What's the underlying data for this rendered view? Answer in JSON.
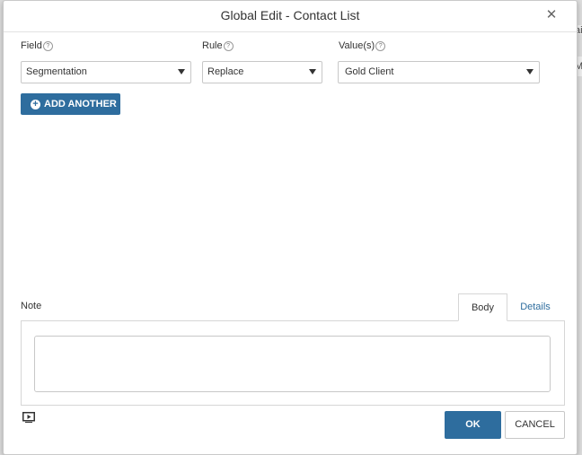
{
  "dialog": {
    "title": "Global Edit - Contact List",
    "close_glyph": "✕"
  },
  "background": {
    "fragments": [
      "ai",
      "M",
      ":"
    ]
  },
  "form": {
    "field": {
      "label": "Field",
      "value": "Segmentation"
    },
    "rule": {
      "label": "Rule",
      "value": "Replace"
    },
    "values": {
      "label": "Value(s)",
      "value": "Gold Client"
    },
    "help_glyph": "?",
    "add_another_label": "ADD ANOTHER"
  },
  "note": {
    "label": "Note",
    "tabs": [
      {
        "label": "Body",
        "active": true
      },
      {
        "label": "Details",
        "active": false
      }
    ],
    "body_text": ""
  },
  "footer": {
    "ok_label": "OK",
    "cancel_label": "CANCEL"
  },
  "colors": {
    "primary": "#2e6d9e",
    "link": "#2e6d9e"
  },
  "icons": [
    "help-icon",
    "close-icon",
    "plus-circle-icon",
    "caret-down-icon",
    "video-play-icon"
  ]
}
